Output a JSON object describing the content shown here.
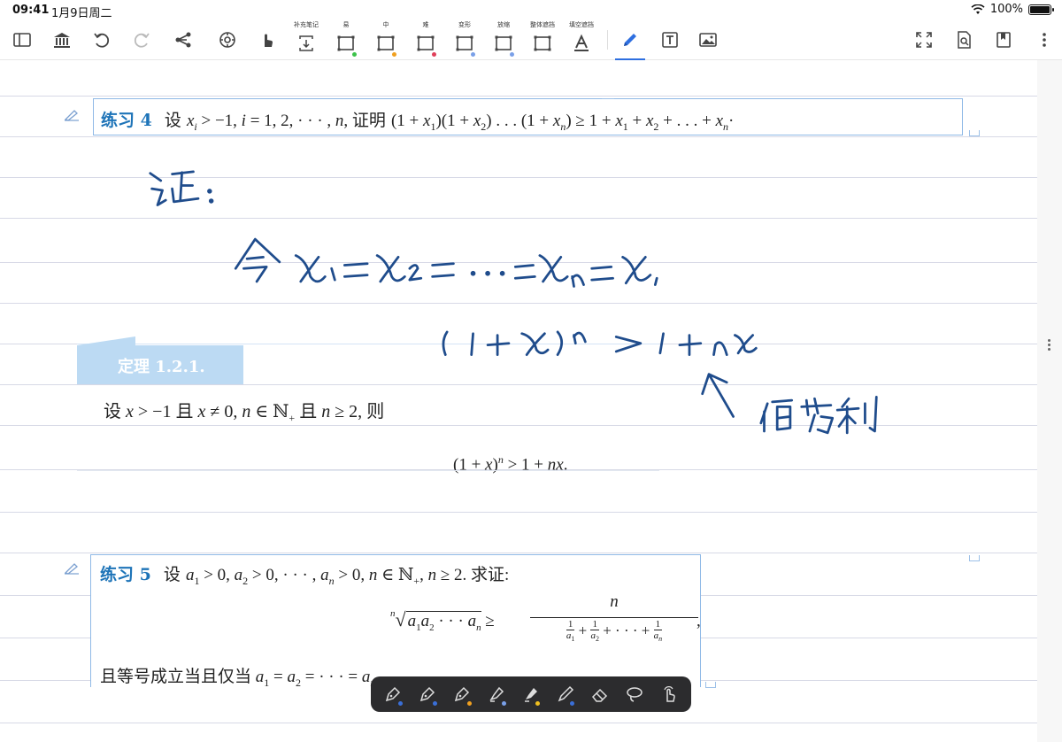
{
  "status": {
    "time": "09:41",
    "date": "1月9日周二",
    "battery": "100%"
  },
  "toolbar": {
    "left_tools": [
      {
        "name": "sidebar-toggle-icon"
      },
      {
        "name": "library-icon"
      },
      {
        "name": "undo-icon"
      },
      {
        "name": "redo-icon"
      },
      {
        "name": "mindmap-icon"
      },
      {
        "name": "sync-icon"
      },
      {
        "name": "hand-pointer-icon"
      }
    ],
    "mask_tools": [
      {
        "label": "补充笔记",
        "name": "supplement-note-tool",
        "dot": ""
      },
      {
        "label": "易",
        "name": "easy-mask-tool",
        "dot": "#3cc24a"
      },
      {
        "label": "中",
        "name": "medium-mask-tool",
        "dot": "#f0a020"
      },
      {
        "label": "难",
        "name": "hard-mask-tool",
        "dot": "#e0405a"
      },
      {
        "label": "变形",
        "name": "transform-mask-tool",
        "dot": "#7aa0e8"
      },
      {
        "label": "放缩",
        "name": "scale-mask-tool",
        "dot": "#7aa0e8"
      },
      {
        "label": "整体遮挡",
        "name": "whole-mask-tool",
        "dot": ""
      },
      {
        "label": "填空遮挡",
        "name": "cloze-mask-tool",
        "dot": ""
      }
    ],
    "accent": "#2e6fe0"
  },
  "exercise4": {
    "title": "练习 4",
    "text_prefix": "设",
    "cond": "x",
    "text_mid": "证明",
    "suffix": "·"
  },
  "theorem": {
    "title": "定理 1.2.1.",
    "t1": "设",
    "t2": "且",
    "t3": "且",
    "t4": "则"
  },
  "exercise5": {
    "title": "练习 5",
    "text_prefix": "设",
    "tail": "求证:",
    "last_line": "且等号成立当且仅当"
  },
  "pen_tools": [
    {
      "name": "fountain-pen-1-icon",
      "dot": "#3a6fd8"
    },
    {
      "name": "fountain-pen-2-icon",
      "dot": "#3a6fd8"
    },
    {
      "name": "fountain-pen-3-icon",
      "dot": "#f0a020"
    },
    {
      "name": "highlighter-1-icon",
      "dot": "#7aa0e8"
    },
    {
      "name": "highlighter-2-icon",
      "dot": "#f0c020"
    },
    {
      "name": "pencil-icon",
      "dot": "#3a6fd8"
    },
    {
      "name": "eraser-icon",
      "dot": ""
    },
    {
      "name": "lasso-icon",
      "dot": ""
    },
    {
      "name": "touch-icon",
      "dot": ""
    }
  ]
}
